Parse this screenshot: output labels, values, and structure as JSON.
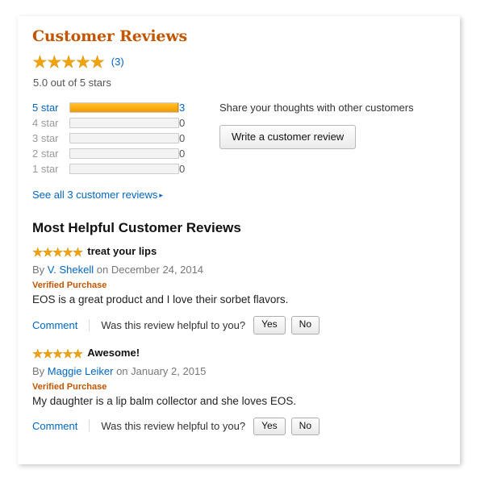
{
  "card": {
    "section_title": "Customer Reviews",
    "summary": {
      "stars_glyphs": "★★★★★",
      "review_count_label": "(3)",
      "rating_text": "5.0 out of 5 stars"
    },
    "histogram": {
      "rows": [
        {
          "label": "5 star",
          "percent": 100,
          "count": "3",
          "is_link": true
        },
        {
          "label": "4 star",
          "percent": 0,
          "count": "0",
          "is_link": false
        },
        {
          "label": "3 star",
          "percent": 0,
          "count": "0",
          "is_link": false
        },
        {
          "label": "2 star",
          "percent": 0,
          "count": "0",
          "is_link": false
        },
        {
          "label": "1 star",
          "percent": 0,
          "count": "0",
          "is_link": false
        }
      ],
      "see_all_label": "See all 3 customer reviews",
      "see_all_arrow": "▸"
    },
    "share": {
      "prompt": "Share your thoughts with other customers",
      "write_review_label": "Write a customer review"
    },
    "reviews_heading": "Most Helpful Customer Reviews",
    "reviews": [
      {
        "stars_glyphs": "★★★★★",
        "title": "treat your lips",
        "by_label": "By",
        "author": "V. Shekell",
        "on_label": "on",
        "date": "December 24, 2014",
        "verified_badge": "Verified Purchase",
        "body": "EOS is a great product and I love their sorbet flavors.",
        "comment_label": "Comment",
        "helpful_question": "Was this review helpful to you?",
        "yes_label": "Yes",
        "no_label": "No"
      },
      {
        "stars_glyphs": "★★★★★",
        "title": "Awesome!",
        "by_label": "By",
        "author": "Maggie Leiker",
        "on_label": "on",
        "date": "January 2, 2015",
        "verified_badge": "Verified Purchase",
        "body": "My daughter is a lip balm collector and she loves EOS.",
        "comment_label": "Comment",
        "helpful_question": "Was this review helpful to you?",
        "yes_label": "Yes",
        "no_label": "No"
      }
    ]
  },
  "colors": {
    "accent_orange": "#C45500",
    "star_gold": "#F0A30A",
    "link_blue": "#0066C0",
    "bar_empty": "#F3F3F3",
    "bar_border": "#CCCCCC"
  }
}
